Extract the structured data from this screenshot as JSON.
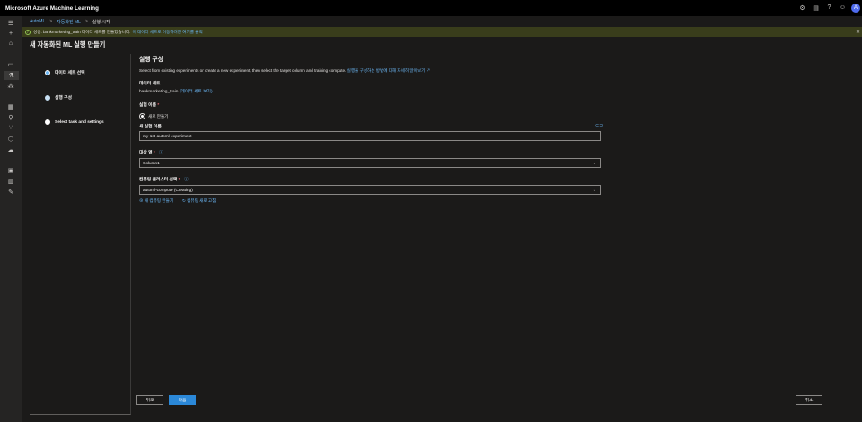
{
  "topbar": {
    "title": "Microsoft Azure Machine Learning",
    "icons": [
      "gear-icon",
      "feedback-icon",
      "help-icon",
      "smiley-icon"
    ],
    "avatar_letter": "A"
  },
  "breadcrumb": [
    "AutoML",
    "자동화된 ML",
    "실행 시작"
  ],
  "notice": {
    "message": "성공: bankmarketing_train 데이터 세트를 만들었습니다.",
    "link": "이 데이터 세트로 이동하려면 여기를 클릭"
  },
  "page_title": "새 자동화된 ML 실행 만들기",
  "steps": [
    {
      "label": "데이터 세트 선택",
      "state": "done"
    },
    {
      "label": "실행 구성",
      "state": "current"
    },
    {
      "label": "Select task and settings",
      "state": "pending"
    }
  ],
  "form": {
    "heading": "실행 구성",
    "description": "Select from existing experiments or create a new experiment, then select the target column and training compute.",
    "description_link": "실행을 구성하는 방법에 대해 자세히 알아보기 ↗",
    "dataset_label": "데이터 세트",
    "dataset_name": "bankmarketing_train",
    "dataset_link": "(데이터 세트 보기)",
    "experiment_label": "실험 이름",
    "radio_new": "새로 만들기",
    "new_experiment_label": "새 실험 이름",
    "new_experiment_value": "my-1st-automl-experiment",
    "target_label": "대상 열",
    "target_value": "Column1",
    "compute_label": "컴퓨팅 클러스터 선택",
    "compute_value": "automl-compute (Creating)",
    "new_compute_link": "새 컴퓨팅 만들기",
    "refresh_compute_link": "컴퓨팅 새로 고침",
    "required_mark": "*"
  },
  "buttons": {
    "back": "뒤로",
    "next": "다음",
    "cancel": "취소"
  },
  "colors": {
    "accent": "#2b88d8",
    "link": "#6cb8f6",
    "notice_bg": "#393d1b",
    "success": "#92c353"
  }
}
